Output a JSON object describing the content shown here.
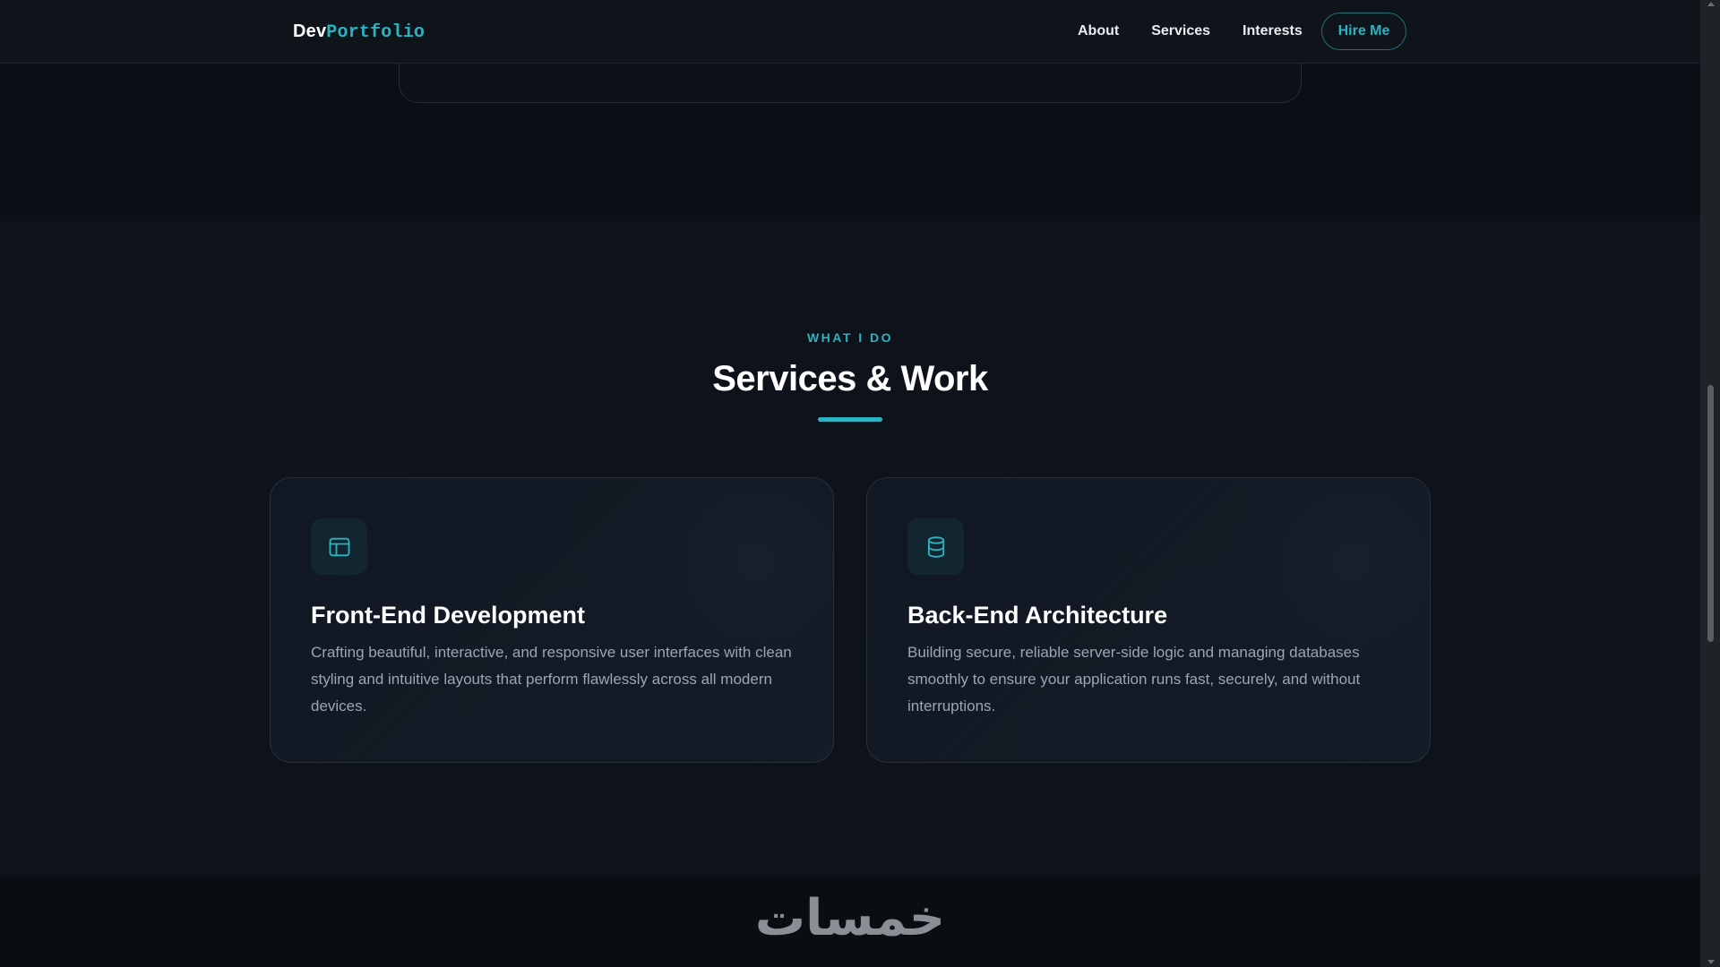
{
  "nav": {
    "logo_prefix": "Dev",
    "logo_suffix": "Portfolio",
    "links": [
      {
        "label": "About"
      },
      {
        "label": "Services"
      },
      {
        "label": "Interests"
      }
    ],
    "cta_label": "Hire Me"
  },
  "services": {
    "eyebrow": "WHAT I DO",
    "title": "Services & Work",
    "cards": [
      {
        "icon": "browser-window-icon",
        "title": "Front-End Development",
        "description": "Crafting beautiful, interactive, and responsive user interfaces with clean styling and intuitive layouts that perform flawlessly across all modern devices."
      },
      {
        "icon": "database-icon",
        "title": "Back-End Architecture",
        "description": "Building secure, reliable server-side logic and managing databases smoothly to ensure your application runs fast, securely, and without interruptions."
      }
    ]
  },
  "footer": {
    "logo_text": "خمسات"
  },
  "colors": {
    "accent": "#2bb3c2",
    "background": "#0b0f15",
    "section_bg": "#0e131b",
    "card_border": "#263039"
  }
}
